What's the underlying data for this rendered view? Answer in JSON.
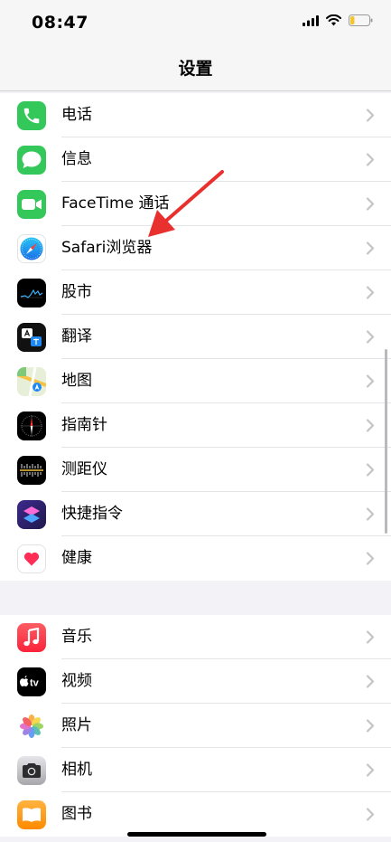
{
  "status_bar": {
    "time": "08:47"
  },
  "nav": {
    "title": "设置"
  },
  "group1": [
    {
      "label": "电话",
      "icon": "phone-icon",
      "color": "#34c759"
    },
    {
      "label": "信息",
      "icon": "messages-icon",
      "color": "#34c759"
    },
    {
      "label": "FaceTime 通话",
      "icon": "facetime-icon",
      "color": "#34c759"
    },
    {
      "label": "Safari浏览器",
      "icon": "safari-icon",
      "color": "#1e88f5"
    },
    {
      "label": "股市",
      "icon": "stocks-icon",
      "color": "#000000"
    },
    {
      "label": "翻译",
      "icon": "translate-icon",
      "color": "#000000"
    },
    {
      "label": "地图",
      "icon": "maps-icon",
      "color": "#7fc97a"
    },
    {
      "label": "指南针",
      "icon": "compass-icon",
      "color": "#000000"
    },
    {
      "label": "测距仪",
      "icon": "measure-icon",
      "color": "#000000"
    },
    {
      "label": "快捷指令",
      "icon": "shortcuts-icon",
      "color": "#5a3ec8"
    },
    {
      "label": "健康",
      "icon": "health-icon",
      "color": "#ff2d55"
    }
  ],
  "group2": [
    {
      "label": "音乐",
      "icon": "music-icon",
      "color": "#fc3c44"
    },
    {
      "label": "视频",
      "icon": "tv-icon",
      "color": "#000000"
    },
    {
      "label": "照片",
      "icon": "photos-icon",
      "color": "#ffffff"
    },
    {
      "label": "相机",
      "icon": "camera-icon",
      "color": "#8e8e93"
    },
    {
      "label": "图书",
      "icon": "books-icon",
      "color": "#ff9500"
    }
  ],
  "tv_text": "tv",
  "annotation": {
    "color": "#e8312f"
  }
}
